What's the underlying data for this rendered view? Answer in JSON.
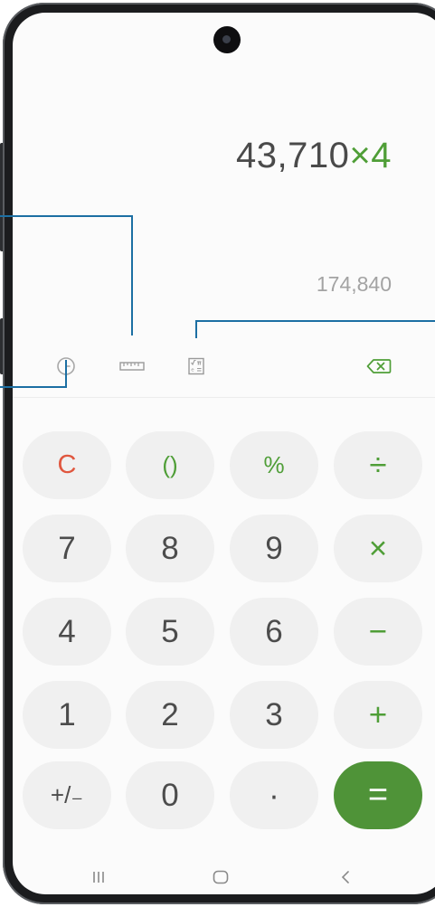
{
  "display": {
    "expression_number": "43,710",
    "expression_operator": "×4",
    "result_preview": "174,840"
  },
  "toolbar": {
    "history_icon": "clock-icon",
    "unit_converter_icon": "ruler-icon",
    "scientific_icon": "scientific-calculator-icon",
    "backspace_icon": "backspace-icon"
  },
  "keypad": {
    "row1": [
      "C",
      "()",
      "%",
      "÷"
    ],
    "row2": [
      "7",
      "8",
      "9",
      "×"
    ],
    "row3": [
      "4",
      "5",
      "6",
      "−"
    ],
    "row4": [
      "1",
      "2",
      "3",
      "+"
    ],
    "row5": [
      "+/₋",
      "0",
      "·",
      "="
    ]
  },
  "nav_bar": {
    "recents": "recent-apps-icon",
    "home": "home-icon",
    "back": "back-icon"
  },
  "colors": {
    "accent_green": "#4f9e37",
    "clear_red": "#e0573f",
    "equals_bg": "#4f9338",
    "callout_blue": "#1c6fa3"
  }
}
